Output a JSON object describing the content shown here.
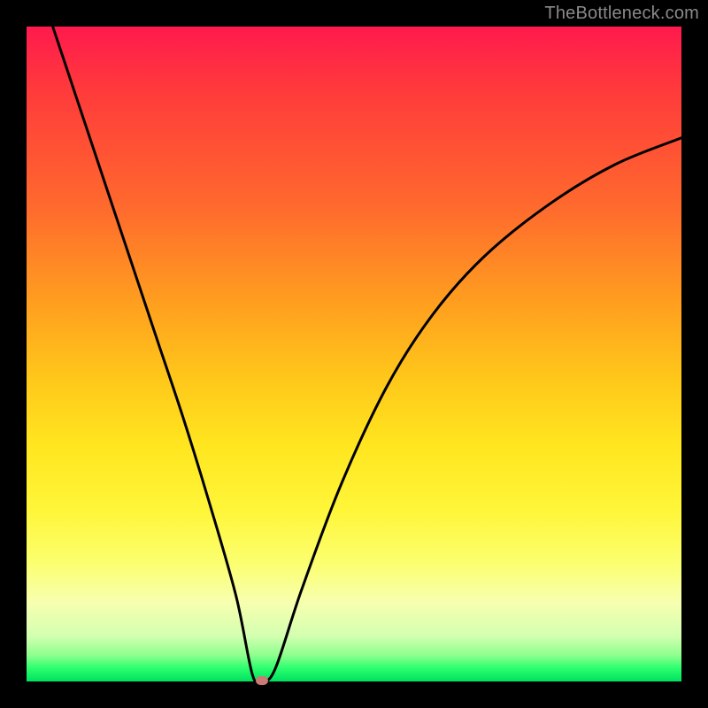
{
  "watermark": "TheBottleneck.com",
  "chart_data": {
    "type": "line",
    "title": "",
    "xlabel": "",
    "ylabel": "",
    "xlim": [
      0,
      1
    ],
    "ylim": [
      0,
      1
    ],
    "series": [
      {
        "name": "bottleneck-curve",
        "x": [
          0.04,
          0.08,
          0.12,
          0.16,
          0.2,
          0.24,
          0.28,
          0.32,
          0.345,
          0.36,
          0.38,
          0.42,
          0.48,
          0.55,
          0.62,
          0.7,
          0.8,
          0.9,
          1.0
        ],
        "y": [
          1.0,
          0.88,
          0.76,
          0.64,
          0.52,
          0.4,
          0.27,
          0.13,
          0.01,
          0.0,
          0.02,
          0.14,
          0.3,
          0.45,
          0.56,
          0.65,
          0.73,
          0.79,
          0.83
        ]
      }
    ],
    "marker": {
      "x": 0.36,
      "y": 0.0
    },
    "gradient_stops": [
      {
        "pos": 0.0,
        "color": "#ff1a4d"
      },
      {
        "pos": 0.5,
        "color": "#ffd21f"
      },
      {
        "pos": 0.9,
        "color": "#f7ffb0"
      },
      {
        "pos": 1.0,
        "color": "#00e060"
      }
    ]
  }
}
